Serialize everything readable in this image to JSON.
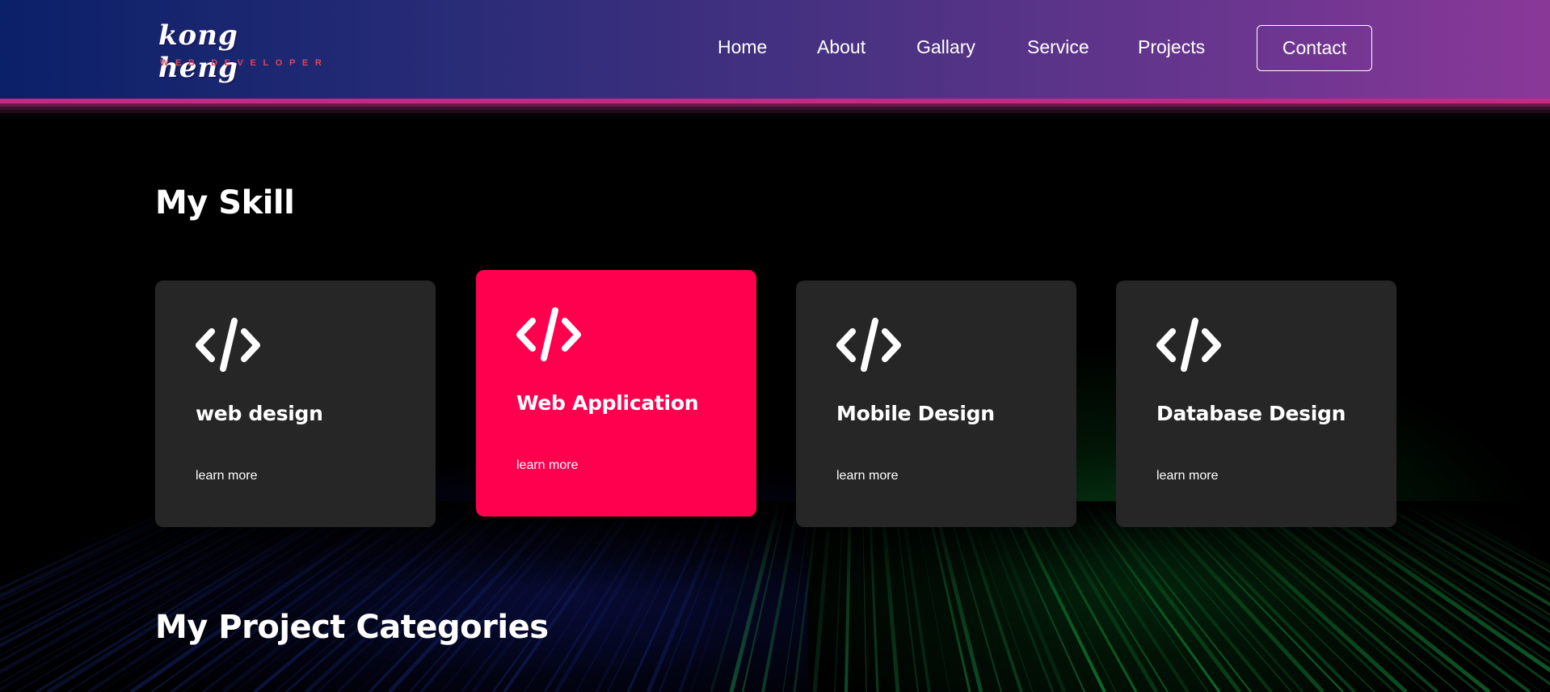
{
  "header": {
    "logo": {
      "title": "kong heng",
      "subtitle": "WEB DEVELOPER"
    },
    "nav": {
      "home": "Home",
      "about": "About",
      "gallary": "Gallary",
      "service": "Service",
      "projects": "Projects",
      "contact": "Contact"
    }
  },
  "skills": {
    "title": "My Skill",
    "cards": [
      {
        "icon": "code-icon",
        "title": "web design",
        "link": "learn more",
        "highlighted": false
      },
      {
        "icon": "code-icon",
        "title": "Web Application",
        "link": "learn more",
        "highlighted": true
      },
      {
        "icon": "code-icon",
        "title": "Mobile Design",
        "link": "learn more",
        "highlighted": false
      },
      {
        "icon": "code-icon",
        "title": "Database Design",
        "link": "learn more",
        "highlighted": false
      }
    ]
  },
  "projects": {
    "title": "My Project Categories"
  },
  "colors": {
    "accent": "#ff004e",
    "card": "#262626",
    "header_start": "#0a2068",
    "header_end": "#8a3898",
    "logo_subtitle": "#d6485e"
  }
}
